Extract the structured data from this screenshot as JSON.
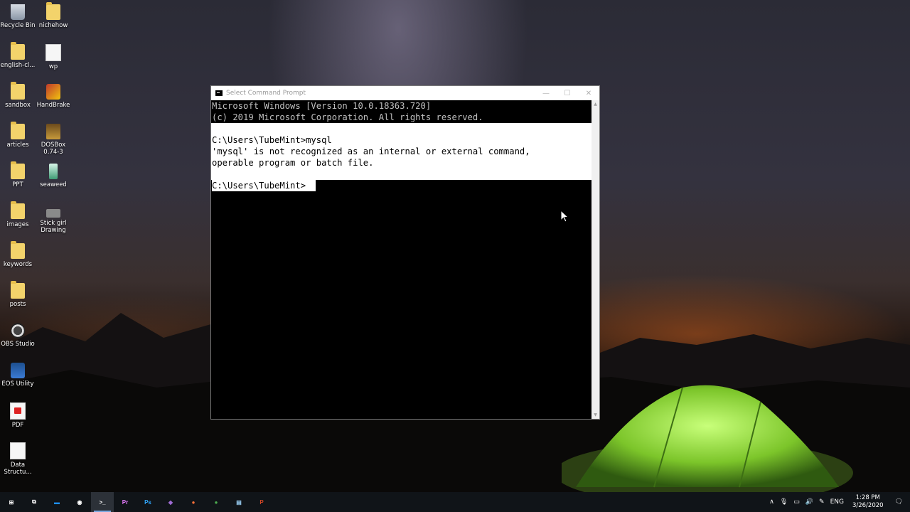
{
  "desktop": {
    "icons_left": [
      {
        "label": "Recycle Bin",
        "icon": "recycle-bin-icon"
      },
      {
        "label": "english-cl...",
        "icon": "folder-icon"
      },
      {
        "label": "sandbox",
        "icon": "folder-icon"
      },
      {
        "label": "articles",
        "icon": "folder-icon"
      },
      {
        "label": "PPT",
        "icon": "folder-icon"
      },
      {
        "label": "images",
        "icon": "folder-icon"
      },
      {
        "label": "keywords",
        "icon": "folder-icon"
      },
      {
        "label": "posts",
        "icon": "folder-icon"
      },
      {
        "label": "OBS Studio",
        "icon": "obs-studio-icon"
      },
      {
        "label": "EOS Utility",
        "icon": "eos-utility-icon"
      },
      {
        "label": "PDF",
        "icon": "pdf-icon"
      },
      {
        "label": "Data Structu...",
        "icon": "document-icon"
      }
    ],
    "icons_right": [
      {
        "label": "nichehow",
        "icon": "folder-icon"
      },
      {
        "label": "wp",
        "icon": "document-icon"
      },
      {
        "label": "HandBrake",
        "icon": "handbrake-icon"
      },
      {
        "label": "DOSBox 0.74-3",
        "icon": "dosbox-icon"
      },
      {
        "label": "seaweed",
        "icon": "seaweed-icon"
      },
      {
        "label": "Stick girl Drawing",
        "icon": "image-file-icon"
      }
    ]
  },
  "cmd": {
    "title": "Select Command Prompt",
    "minimize": "—",
    "maximize": "☐",
    "close": "✕",
    "lines": [
      "Microsoft Windows [Version 10.0.18363.720]",
      "(c) 2019 Microsoft Corporation. All rights reserved.",
      "",
      "C:\\Users\\TubeMint>mysql",
      "'mysql' is not recognized as an internal or external command,",
      "operable program or batch file.",
      "",
      "C:\\Users\\TubeMint>"
    ]
  },
  "taskbar": {
    "apps": [
      {
        "name": "start-button",
        "glyph": "⊞",
        "color": "#ffffff"
      },
      {
        "name": "task-view-button",
        "glyph": "⧉",
        "color": "#ffffff"
      },
      {
        "name": "file-explorer-button",
        "glyph": "▬",
        "color": "#1e90ff"
      },
      {
        "name": "obs-taskbar-button",
        "glyph": "◉",
        "color": "#ffffff"
      },
      {
        "name": "command-prompt-taskbar-button",
        "glyph": ">_",
        "color": "#ffffff"
      },
      {
        "name": "premiere-taskbar-button",
        "glyph": "Pr",
        "color": "#e77bff"
      },
      {
        "name": "photoshop-taskbar-button",
        "glyph": "Ps",
        "color": "#31a8ff"
      },
      {
        "name": "visual-studio-taskbar-button",
        "glyph": "◆",
        "color": "#a06cd5"
      },
      {
        "name": "firefox-taskbar-button",
        "glyph": "●",
        "color": "#ff7139"
      },
      {
        "name": "chrome-taskbar-button",
        "glyph": "●",
        "color": "#4caf50"
      },
      {
        "name": "notepad-taskbar-button",
        "glyph": "▤",
        "color": "#9ad0f5"
      },
      {
        "name": "powerpoint-taskbar-button",
        "glyph": "P",
        "color": "#d24726"
      }
    ],
    "tray": {
      "language": "ENG",
      "time": "1:28 PM",
      "date": "3/26/2020"
    }
  }
}
